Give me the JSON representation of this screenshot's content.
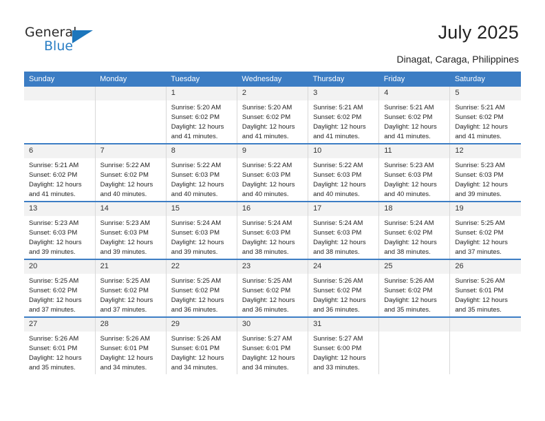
{
  "brand": {
    "name_part1": "General",
    "name_part2": "Blue",
    "accent_color": "#1c76bc"
  },
  "header": {
    "title": "July 2025",
    "location": "Dinagat, Caraga, Philippines"
  },
  "calendar": {
    "header_color": "#3c7dc4",
    "daynum_band_color": "#f2f2f2",
    "weekday_labels": [
      "Sunday",
      "Monday",
      "Tuesday",
      "Wednesday",
      "Thursday",
      "Friday",
      "Saturday"
    ],
    "weeks": [
      [
        {
          "day": "",
          "lines": []
        },
        {
          "day": "",
          "lines": []
        },
        {
          "day": "1",
          "lines": [
            "Sunrise: 5:20 AM",
            "Sunset: 6:02 PM",
            "Daylight: 12 hours",
            "and 41 minutes."
          ]
        },
        {
          "day": "2",
          "lines": [
            "Sunrise: 5:20 AM",
            "Sunset: 6:02 PM",
            "Daylight: 12 hours",
            "and 41 minutes."
          ]
        },
        {
          "day": "3",
          "lines": [
            "Sunrise: 5:21 AM",
            "Sunset: 6:02 PM",
            "Daylight: 12 hours",
            "and 41 minutes."
          ]
        },
        {
          "day": "4",
          "lines": [
            "Sunrise: 5:21 AM",
            "Sunset: 6:02 PM",
            "Daylight: 12 hours",
            "and 41 minutes."
          ]
        },
        {
          "day": "5",
          "lines": [
            "Sunrise: 5:21 AM",
            "Sunset: 6:02 PM",
            "Daylight: 12 hours",
            "and 41 minutes."
          ]
        }
      ],
      [
        {
          "day": "6",
          "lines": [
            "Sunrise: 5:21 AM",
            "Sunset: 6:02 PM",
            "Daylight: 12 hours",
            "and 41 minutes."
          ]
        },
        {
          "day": "7",
          "lines": [
            "Sunrise: 5:22 AM",
            "Sunset: 6:02 PM",
            "Daylight: 12 hours",
            "and 40 minutes."
          ]
        },
        {
          "day": "8",
          "lines": [
            "Sunrise: 5:22 AM",
            "Sunset: 6:03 PM",
            "Daylight: 12 hours",
            "and 40 minutes."
          ]
        },
        {
          "day": "9",
          "lines": [
            "Sunrise: 5:22 AM",
            "Sunset: 6:03 PM",
            "Daylight: 12 hours",
            "and 40 minutes."
          ]
        },
        {
          "day": "10",
          "lines": [
            "Sunrise: 5:22 AM",
            "Sunset: 6:03 PM",
            "Daylight: 12 hours",
            "and 40 minutes."
          ]
        },
        {
          "day": "11",
          "lines": [
            "Sunrise: 5:23 AM",
            "Sunset: 6:03 PM",
            "Daylight: 12 hours",
            "and 40 minutes."
          ]
        },
        {
          "day": "12",
          "lines": [
            "Sunrise: 5:23 AM",
            "Sunset: 6:03 PM",
            "Daylight: 12 hours",
            "and 39 minutes."
          ]
        }
      ],
      [
        {
          "day": "13",
          "lines": [
            "Sunrise: 5:23 AM",
            "Sunset: 6:03 PM",
            "Daylight: 12 hours",
            "and 39 minutes."
          ]
        },
        {
          "day": "14",
          "lines": [
            "Sunrise: 5:23 AM",
            "Sunset: 6:03 PM",
            "Daylight: 12 hours",
            "and 39 minutes."
          ]
        },
        {
          "day": "15",
          "lines": [
            "Sunrise: 5:24 AM",
            "Sunset: 6:03 PM",
            "Daylight: 12 hours",
            "and 39 minutes."
          ]
        },
        {
          "day": "16",
          "lines": [
            "Sunrise: 5:24 AM",
            "Sunset: 6:03 PM",
            "Daylight: 12 hours",
            "and 38 minutes."
          ]
        },
        {
          "day": "17",
          "lines": [
            "Sunrise: 5:24 AM",
            "Sunset: 6:03 PM",
            "Daylight: 12 hours",
            "and 38 minutes."
          ]
        },
        {
          "day": "18",
          "lines": [
            "Sunrise: 5:24 AM",
            "Sunset: 6:02 PM",
            "Daylight: 12 hours",
            "and 38 minutes."
          ]
        },
        {
          "day": "19",
          "lines": [
            "Sunrise: 5:25 AM",
            "Sunset: 6:02 PM",
            "Daylight: 12 hours",
            "and 37 minutes."
          ]
        }
      ],
      [
        {
          "day": "20",
          "lines": [
            "Sunrise: 5:25 AM",
            "Sunset: 6:02 PM",
            "Daylight: 12 hours",
            "and 37 minutes."
          ]
        },
        {
          "day": "21",
          "lines": [
            "Sunrise: 5:25 AM",
            "Sunset: 6:02 PM",
            "Daylight: 12 hours",
            "and 37 minutes."
          ]
        },
        {
          "day": "22",
          "lines": [
            "Sunrise: 5:25 AM",
            "Sunset: 6:02 PM",
            "Daylight: 12 hours",
            "and 36 minutes."
          ]
        },
        {
          "day": "23",
          "lines": [
            "Sunrise: 5:25 AM",
            "Sunset: 6:02 PM",
            "Daylight: 12 hours",
            "and 36 minutes."
          ]
        },
        {
          "day": "24",
          "lines": [
            "Sunrise: 5:26 AM",
            "Sunset: 6:02 PM",
            "Daylight: 12 hours",
            "and 36 minutes."
          ]
        },
        {
          "day": "25",
          "lines": [
            "Sunrise: 5:26 AM",
            "Sunset: 6:02 PM",
            "Daylight: 12 hours",
            "and 35 minutes."
          ]
        },
        {
          "day": "26",
          "lines": [
            "Sunrise: 5:26 AM",
            "Sunset: 6:01 PM",
            "Daylight: 12 hours",
            "and 35 minutes."
          ]
        }
      ],
      [
        {
          "day": "27",
          "lines": [
            "Sunrise: 5:26 AM",
            "Sunset: 6:01 PM",
            "Daylight: 12 hours",
            "and 35 minutes."
          ]
        },
        {
          "day": "28",
          "lines": [
            "Sunrise: 5:26 AM",
            "Sunset: 6:01 PM",
            "Daylight: 12 hours",
            "and 34 minutes."
          ]
        },
        {
          "day": "29",
          "lines": [
            "Sunrise: 5:26 AM",
            "Sunset: 6:01 PM",
            "Daylight: 12 hours",
            "and 34 minutes."
          ]
        },
        {
          "day": "30",
          "lines": [
            "Sunrise: 5:27 AM",
            "Sunset: 6:01 PM",
            "Daylight: 12 hours",
            "and 34 minutes."
          ]
        },
        {
          "day": "31",
          "lines": [
            "Sunrise: 5:27 AM",
            "Sunset: 6:00 PM",
            "Daylight: 12 hours",
            "and 33 minutes."
          ]
        },
        {
          "day": "",
          "lines": []
        },
        {
          "day": "",
          "lines": []
        }
      ]
    ]
  }
}
